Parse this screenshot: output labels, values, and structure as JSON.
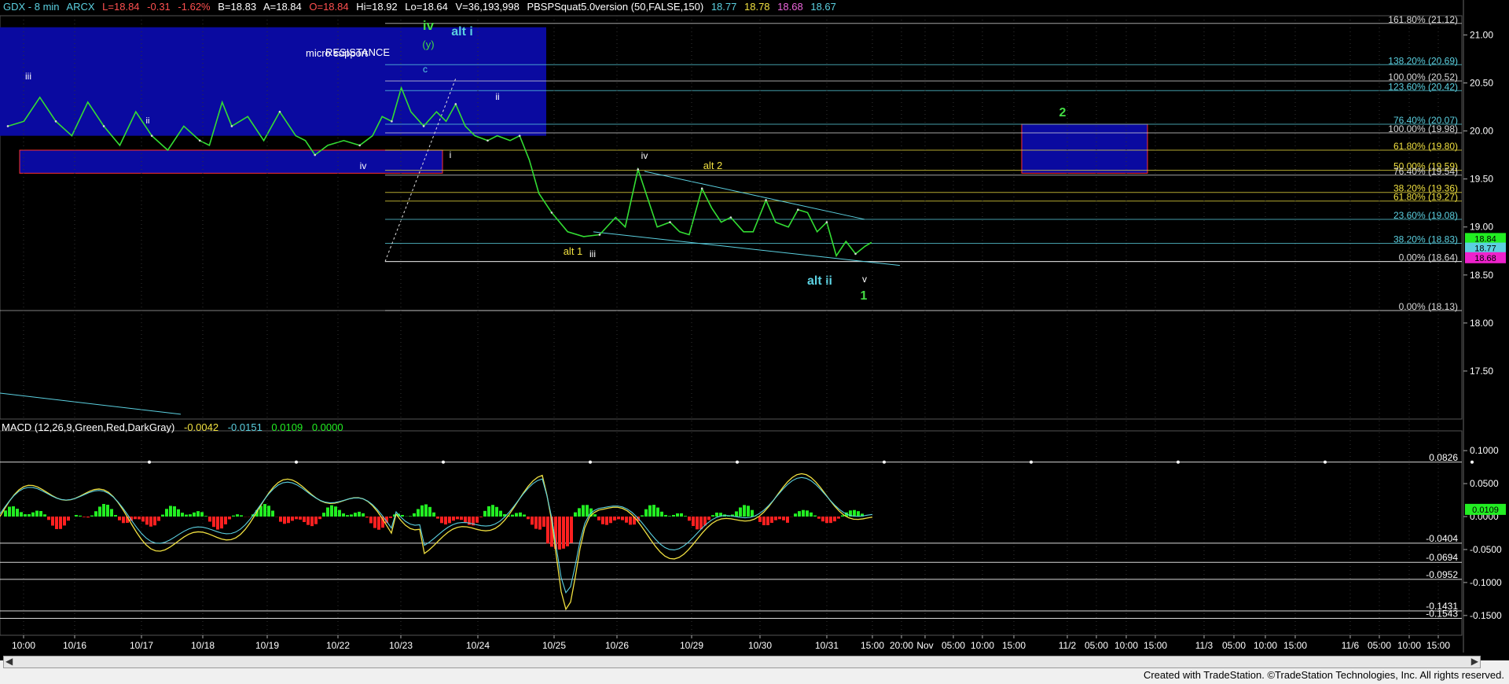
{
  "header": {
    "symbol": "GDX - 8 min",
    "exchange": "ARCX",
    "last": "L=18.84",
    "change": "-0.31",
    "pct": "-1.62%",
    "bid": "B=18.83",
    "ask": "A=18.84",
    "open": "O=18.84",
    "high": "Hi=18.92",
    "low": "Lo=18.64",
    "volume": "V=36,193,998",
    "study": "PBSPSquat5.0version (50,FALSE,150)",
    "v1": "18.77",
    "v2": "18.78",
    "v3": "18.68",
    "v4": "18.67"
  },
  "macd_header": {
    "label": "MACD (12,26,9,Green,Red,DarkGray)",
    "v1": "-0.0042",
    "v2": "-0.0151",
    "v3": "0.0109",
    "v4": "0.0000"
  },
  "credit": "Created with TradeStation. ©TradeStation Technologies, Inc. All rights reserved.",
  "colors": {
    "background": "#000000",
    "price": "#33dd33",
    "resistance_box": "#0a0aa0",
    "box_border": "#ff3030",
    "fib_line": "#d8d8d8",
    "cyan": "#5bd0e0",
    "yellow": "#f0e040",
    "green_label": "#44dd44",
    "macd_up": "#22ee22",
    "macd_down": "#ff2020"
  },
  "chart_data": [
    {
      "type": "line",
      "name": "price",
      "ylim": [
        17.0,
        21.2
      ],
      "y_ticks": [
        "21.00",
        "20.50",
        "20.00",
        "19.50",
        "19.00",
        "18.50",
        "18.00",
        "17.50"
      ],
      "x_ticks": [
        "10:00",
        "10/16",
        "10/17",
        "10/18",
        "10/19",
        "10/22",
        "10/23",
        "10/24",
        "10/25",
        "10/26",
        "10/29",
        "10/30",
        "10/31",
        "15:00",
        "20:00",
        "Nov",
        "05:00",
        "10:00",
        "15:00",
        "11/2",
        "05:00",
        "10:00",
        "15:00",
        "11/3",
        "05:00",
        "10:00",
        "15:00",
        "11/6",
        "05:00",
        "10:00",
        "15:00"
      ],
      "series_points": [
        [
          0,
          20.05
        ],
        [
          0.5,
          20.1
        ],
        [
          1,
          20.35
        ],
        [
          1.5,
          20.1
        ],
        [
          2,
          19.95
        ],
        [
          2.5,
          20.3
        ],
        [
          3,
          20.05
        ],
        [
          3.5,
          19.85
        ],
        [
          4,
          20.2
        ],
        [
          4.5,
          19.95
        ],
        [
          5,
          19.8
        ],
        [
          5.5,
          20.05
        ],
        [
          6,
          19.9
        ],
        [
          6.3,
          19.85
        ],
        [
          6.7,
          20.3
        ],
        [
          7,
          20.05
        ],
        [
          7.5,
          20.15
        ],
        [
          8,
          19.9
        ],
        [
          8.5,
          20.2
        ],
        [
          9,
          19.95
        ],
        [
          9.3,
          19.9
        ],
        [
          9.6,
          19.75
        ],
        [
          10,
          19.85
        ],
        [
          10.5,
          19.9
        ],
        [
          11,
          19.85
        ],
        [
          11.4,
          19.95
        ],
        [
          11.7,
          20.15
        ],
        [
          12,
          20.1
        ],
        [
          12.3,
          20.45
        ],
        [
          12.6,
          20.2
        ],
        [
          13,
          20.05
        ],
        [
          13.4,
          20.2
        ],
        [
          13.7,
          20.1
        ],
        [
          14,
          20.28
        ],
        [
          14.3,
          20.05
        ],
        [
          14.6,
          19.95
        ],
        [
          15,
          19.9
        ],
        [
          15.3,
          19.95
        ],
        [
          15.7,
          19.9
        ],
        [
          16,
          19.95
        ],
        [
          16.3,
          19.7
        ],
        [
          16.6,
          19.35
        ],
        [
          17,
          19.15
        ],
        [
          17.5,
          18.95
        ],
        [
          18,
          18.9
        ],
        [
          18.5,
          18.92
        ],
        [
          19,
          19.1
        ],
        [
          19.3,
          19.0
        ],
        [
          19.7,
          19.6
        ],
        [
          20,
          19.3
        ],
        [
          20.3,
          19.0
        ],
        [
          20.7,
          19.05
        ],
        [
          21,
          18.95
        ],
        [
          21.3,
          18.92
        ],
        [
          21.7,
          19.4
        ],
        [
          22,
          19.2
        ],
        [
          22.3,
          19.05
        ],
        [
          22.6,
          19.1
        ],
        [
          23,
          18.95
        ],
        [
          23.3,
          18.95
        ],
        [
          23.7,
          19.28
        ],
        [
          24,
          19.05
        ],
        [
          24.4,
          19.0
        ],
        [
          24.7,
          19.18
        ],
        [
          25,
          19.15
        ],
        [
          25.3,
          18.95
        ],
        [
          25.6,
          19.05
        ],
        [
          25.9,
          18.7
        ],
        [
          26.2,
          18.85
        ],
        [
          26.5,
          18.72
        ],
        [
          26.8,
          18.8
        ],
        [
          27,
          18.84
        ]
      ],
      "fib_levels": [
        {
          "label": "161.80% (21.12)",
          "value": 21.12,
          "color": "#d8d8d8"
        },
        {
          "label": "138.20% (20.69)",
          "value": 20.69,
          "color": "#5bd0e0"
        },
        {
          "label": "100.00% (20.52)",
          "value": 20.52,
          "color": "#d8d8d8"
        },
        {
          "label": "123.60% (20.42)",
          "value": 20.42,
          "color": "#5bd0e0"
        },
        {
          "label": "76.40% (20.07)",
          "value": 20.07,
          "color": "#5bd0e0"
        },
        {
          "label": "100.00% (19.98)",
          "value": 19.98,
          "color": "#d8d8d8"
        },
        {
          "label": "61.80% (19.80)",
          "value": 19.8,
          "color": "#f0e040"
        },
        {
          "label": "50.00% (19.59)",
          "value": 19.59,
          "color": "#f0e040"
        },
        {
          "label": "76.40% (19.54)",
          "value": 19.54,
          "color": "#d8d8d8"
        },
        {
          "label": "38.20% (19.36)",
          "value": 19.36,
          "color": "#f0e040"
        },
        {
          "label": "61.80% (19.27)",
          "value": 19.27,
          "color": "#f0e040"
        },
        {
          "label": "23.60% (19.08)",
          "value": 19.08,
          "color": "#5bd0e0"
        },
        {
          "label": "38.20% (18.83)",
          "value": 18.83,
          "color": "#5bd0e0"
        },
        {
          "label": "0.00% (18.64)",
          "value": 18.64,
          "color": "#d8d8d8"
        },
        {
          "label": "0.00% (18.13)",
          "value": 18.13,
          "color": "#d8d8d8"
        }
      ],
      "price_tags": [
        {
          "text": "18.84",
          "color": "#22ee22"
        },
        {
          "text": "18.77",
          "color": "#5bd0e0"
        },
        {
          "text": "18.68",
          "color": "#ee22cc"
        }
      ],
      "annotations": [
        {
          "text": "RESISTANCE",
          "color": "#ffffff"
        },
        {
          "text": "micro support",
          "color": "#ffffff"
        },
        {
          "text": "iv",
          "color": "#44dd44"
        },
        {
          "text": "(y)",
          "color": "#44dd44"
        },
        {
          "text": "c",
          "color": "#5bd0e0"
        },
        {
          "text": "v",
          "color": "#ffffff"
        },
        {
          "text": "alt i",
          "color": "#5bd0e0"
        },
        {
          "text": "iii",
          "color": "#ffffff"
        },
        {
          "text": "ii",
          "color": "#ffffff"
        },
        {
          "text": "iv",
          "color": "#ffffff"
        },
        {
          "text": "i",
          "color": "#ffffff"
        },
        {
          "text": "ii",
          "color": "#ffffff"
        },
        {
          "text": "iv",
          "color": "#ffffff"
        },
        {
          "text": "alt 2",
          "color": "#f0e040"
        },
        {
          "text": "alt 1",
          "color": "#f0e040"
        },
        {
          "text": "iii",
          "color": "#ffffff"
        },
        {
          "text": "alt ii",
          "color": "#5bd0e0"
        },
        {
          "text": "v",
          "color": "#ffffff"
        },
        {
          "text": "1",
          "color": "#44dd44"
        },
        {
          "text": "2",
          "color": "#44dd44"
        }
      ]
    },
    {
      "type": "line",
      "name": "MACD",
      "ylim": [
        -0.18,
        0.13
      ],
      "y_ticks": [
        "0.1000",
        "0.0500",
        "0.0000",
        "-0.0500",
        "-0.1000",
        "-0.1500"
      ],
      "levels": [
        {
          "label": "0.0826",
          "value": 0.0826
        },
        {
          "label": "-0.0404",
          "value": -0.0404
        },
        {
          "label": "-0.0694",
          "value": -0.0694
        },
        {
          "label": "-0.0952",
          "value": -0.0952
        },
        {
          "label": "-0.1431",
          "value": -0.1431
        },
        {
          "label": "-0.1543",
          "value": -0.1543
        }
      ],
      "current_tag": "0.0109"
    }
  ]
}
